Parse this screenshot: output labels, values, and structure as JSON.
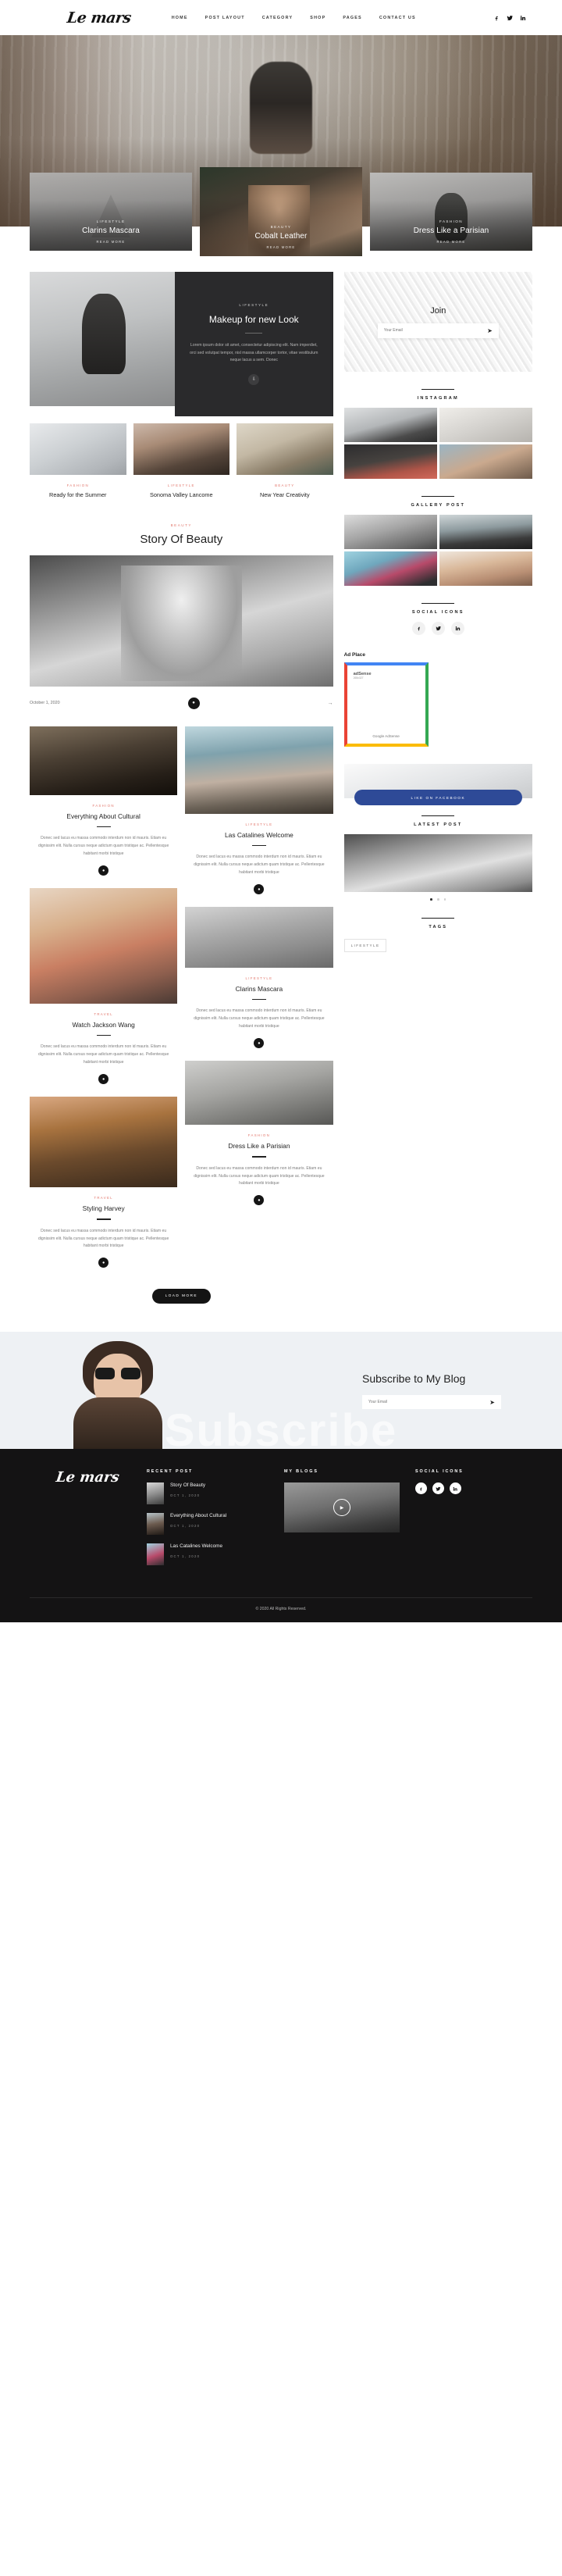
{
  "header": {
    "logo": "Le mars",
    "nav": [
      {
        "label": "HOME"
      },
      {
        "label": "POST LAYOUT"
      },
      {
        "label": "CATEGORY"
      },
      {
        "label": "SHOP"
      },
      {
        "label": "PAGES"
      },
      {
        "label": "CONTACT US"
      }
    ],
    "social": [
      "facebook-icon",
      "twitter-icon",
      "linkedin-icon"
    ]
  },
  "hero": {
    "feature_cards": [
      {
        "category": "LIFESTYLE",
        "title": "Clarins Mascara",
        "read_more": "READ MORE"
      },
      {
        "category": "BEAUTY",
        "title": "Cobalt Leather",
        "read_more": "READ MORE"
      },
      {
        "category": "FASHION",
        "title": "Dress Like a Parisian",
        "read_more": "READ MORE"
      }
    ]
  },
  "dark_card": {
    "category": "LIFESTYLE",
    "title": "Makeup for new Look",
    "excerpt": "Lorem ipsum dolor sit amet, consectetur adipiscing elit. Nam imperdiet, orci sed volutpat tempor, nisl massa ullamcorper tortor, vitae vestibulum neque lacus a sem. Donec"
  },
  "three_posts": [
    {
      "category": "FASHION",
      "title": "Ready for the Summer"
    },
    {
      "category": "LIFESTYLE",
      "title": "Sonoma Valley Lancome"
    },
    {
      "category": "BEAUTY",
      "title": "New Year Creativity"
    }
  ],
  "story": {
    "category": "BEAUTY",
    "title": "Story Of Beauty",
    "date": "October 1, 2020",
    "arrow": "→"
  },
  "masonry": {
    "left": [
      {
        "category": "FASHION",
        "title": "Everything About Cultural",
        "excerpt": "Donec sed lacus eu massa commodo interdum non id mauris. Etiam eu dignissim elit. Nulla cursus neque adictum quam tristique ac. Pellentesque habitant morbi tristique"
      },
      {
        "category": "TRAVEL",
        "title": "Watch Jackson Wang",
        "excerpt": "Donec sed lacus eu massa commodo interdum non id mauris. Etiam eu dignissim elit. Nulla cursus neque adictum quam tristique ac. Pellentesque habitant morbi tristique"
      },
      {
        "category": "TRAVEL",
        "title": "Styling Harvey",
        "excerpt": "Donec sed lacus eu massa commodo interdum non id mauris. Etiam eu dignissim elit. Nulla cursus neque adictum quam tristique ac. Pellentesque habitant morbi tristique"
      }
    ],
    "right": [
      {
        "category": "LIFESTYLE",
        "title": "Las Catalines Welcome",
        "excerpt": "Donec sed lacus eu massa commodo interdum non id mauris. Etiam eu dignissim elit. Nulla cursus neque adictum quam tristique ac. Pellentesque habitant morbi tristique"
      },
      {
        "category": "LIFESTYLE",
        "title": "Clarins Mascara",
        "excerpt": "Donec sed lacus eu massa commodo interdum non id mauris. Etiam eu dignissim elit. Nulla cursus neque adictum quam tristique ac. Pellentesque habitant morbi tristique"
      },
      {
        "category": "FASHION",
        "title": "Dress Like a Parisian",
        "excerpt": "Donec sed lacus eu massa commodo interdum non id mauris. Etiam eu dignissim elit. Nulla cursus neque adictum quam tristique ac. Pellentesque habitant morbi tristique"
      }
    ],
    "load_more": "LOAD MORE"
  },
  "sidebar": {
    "join": {
      "title": "Join",
      "placeholder": "Your Email",
      "send": "➤"
    },
    "instagram": {
      "title": "INSTAGRAM"
    },
    "gallery": {
      "title": "GALLERY POST"
    },
    "social": {
      "title": "SOCIAL ICONS",
      "icons": [
        "facebook-icon",
        "twitter-icon",
        "linkedin-icon"
      ]
    },
    "ad": {
      "title": "Ad Place",
      "label": "adSense",
      "sub": "265x327",
      "footer": "Google AdSense"
    },
    "facebook": {
      "button": "LIKE ON FACEBOOK"
    },
    "latest": {
      "title": "LATEST POST"
    },
    "tags": {
      "title": "TAGS",
      "items": [
        "LIFESTYLE"
      ]
    }
  },
  "subscribe": {
    "heading": "Subscribe to My Blog",
    "placeholder": "Your Email",
    "send": "➤",
    "ghost": "Subscribe"
  },
  "footer": {
    "logo": "Le mars",
    "recent": {
      "title": "RECENT POST",
      "items": [
        {
          "title": "Story Of Beauty",
          "date": "OCT 1, 2020"
        },
        {
          "title": "Everything About Cultural",
          "date": "OCT 1, 2020"
        },
        {
          "title": "Las Catalines Welcome",
          "date": "OCT 1, 2020"
        }
      ]
    },
    "blogs": {
      "title": "MY BLOGS",
      "play": "▶"
    },
    "social": {
      "title": "SOCIAL ICONS",
      "icons": [
        "facebook-icon",
        "twitter-icon",
        "linkedin-icon"
      ]
    },
    "copyright": "© 2020 All Rights Reserved."
  }
}
